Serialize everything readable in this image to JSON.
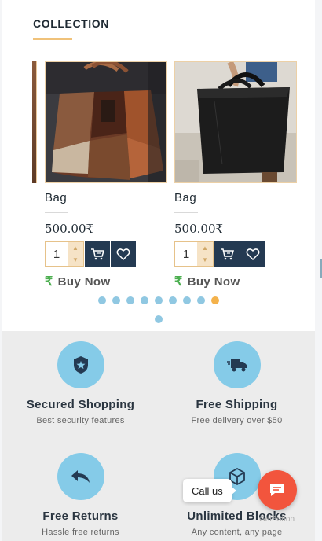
{
  "section": {
    "title": "COLLECTION"
  },
  "products": [
    {
      "name": "Bag",
      "price": "500.00₹",
      "quantity": "1",
      "buy_label": "Buy Now",
      "rupee_symbol": "₹"
    },
    {
      "name": "Bag",
      "price": "500.00₹",
      "quantity": "1",
      "buy_label": "Buy Now",
      "rupee_symbol": "₹"
    }
  ],
  "carousel": {
    "total_dots": 10,
    "active_dot": 9
  },
  "features": [
    {
      "icon": "shield-badge-icon",
      "title": "Secured Shopping",
      "subtitle": "Best security features"
    },
    {
      "icon": "delivery-truck-icon",
      "title": "Free Shipping",
      "subtitle": "Free delivery over $50"
    },
    {
      "icon": "return-arrow-icon",
      "title": "Free Returns",
      "subtitle": "Hassle free returns"
    },
    {
      "icon": "cube-icon",
      "title": "Unlimited Blocks",
      "subtitle": "Any content, any page"
    }
  ],
  "chat_widget": {
    "label": "Call us",
    "brand": "GetButton"
  },
  "colors": {
    "navy": "#243a52",
    "accent": "#f0c27a",
    "feature_circle": "#85cbe8",
    "call_button": "#f2553d",
    "rupee_green": "#4caf50"
  }
}
